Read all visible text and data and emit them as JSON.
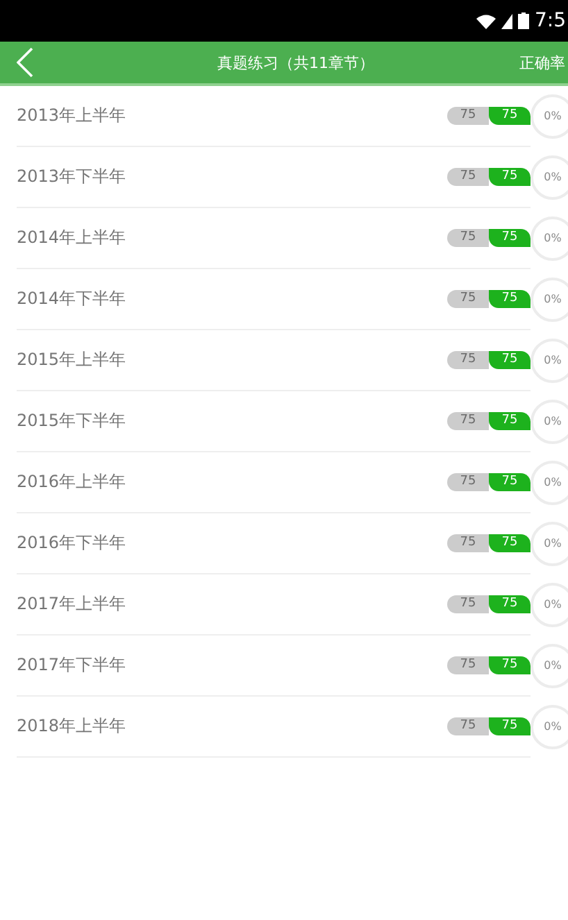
{
  "status_bar": {
    "time": "7:5"
  },
  "header": {
    "title": "真题练习（共11章节）",
    "action": "正确率"
  },
  "rows": [
    {
      "title": "2013年上半年",
      "badges": [
        "75",
        "75"
      ],
      "rate": "0%"
    },
    {
      "title": "2013年下半年",
      "badges": [
        "75",
        "75"
      ],
      "rate": "0%"
    },
    {
      "title": "2014年上半年",
      "badges": [
        "75",
        "75"
      ],
      "rate": "0%"
    },
    {
      "title": "2014年下半年",
      "badges": [
        "75",
        "75"
      ],
      "rate": "0%"
    },
    {
      "title": "2015年上半年",
      "badges": [
        "75",
        "75"
      ],
      "rate": "0%"
    },
    {
      "title": "2015年下半年",
      "badges": [
        "75",
        "75"
      ],
      "rate": "0%"
    },
    {
      "title": "2016年上半年",
      "badges": [
        "75",
        "75"
      ],
      "rate": "0%"
    },
    {
      "title": "2016年下半年",
      "badges": [
        "75",
        "75"
      ],
      "rate": "0%"
    },
    {
      "title": "2017年上半年",
      "badges": [
        "75",
        "75"
      ],
      "rate": "0%"
    },
    {
      "title": "2017年下半年",
      "badges": [
        "75",
        "75"
      ],
      "rate": "0%"
    },
    {
      "title": "2018年上半年",
      "badges": [
        "75",
        "75"
      ],
      "rate": "0%"
    }
  ]
}
